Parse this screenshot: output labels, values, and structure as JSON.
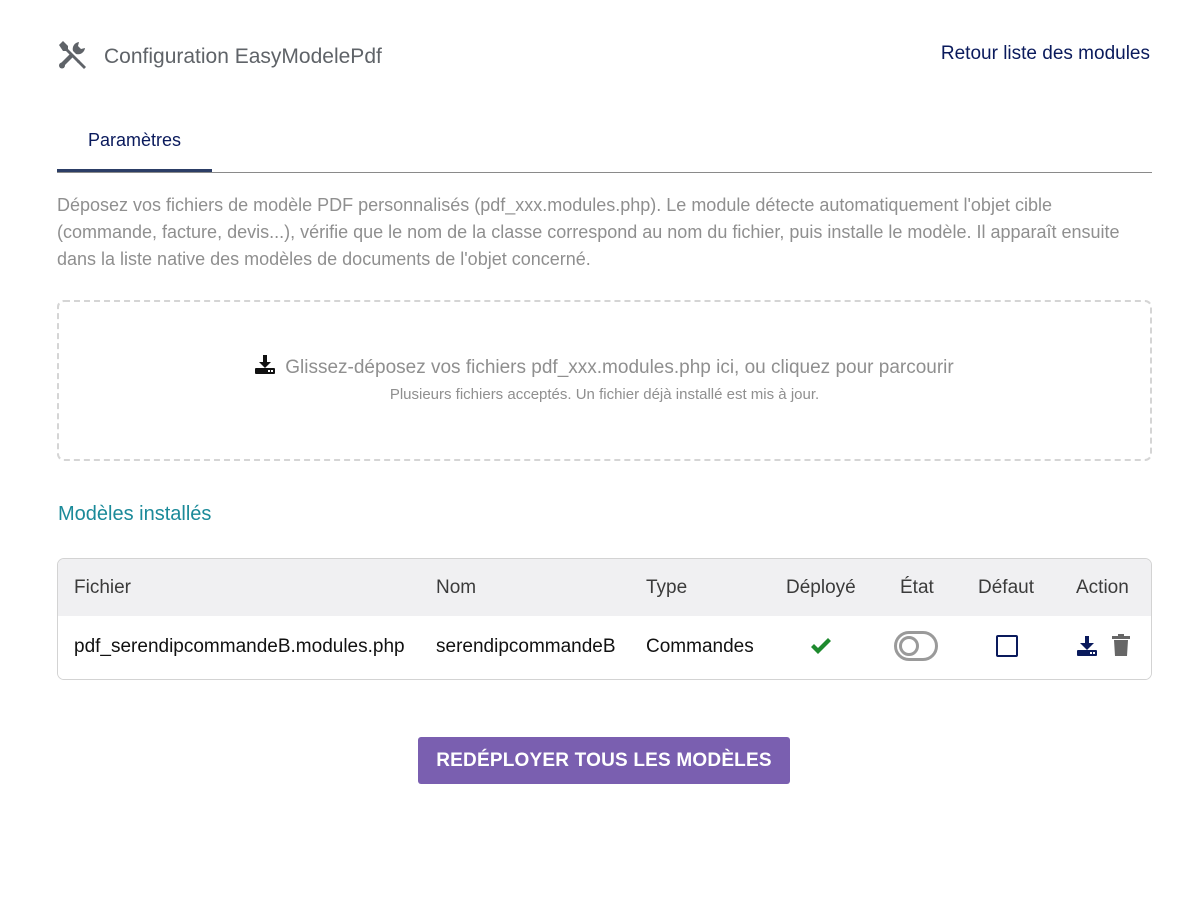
{
  "header": {
    "title": "Configuration EasyModelePdf",
    "back_link": "Retour liste des modules",
    "icon": "tools-icon"
  },
  "tabs": [
    {
      "label": "Paramètres",
      "active": true
    }
  ],
  "description": "Déposez vos fichiers de modèle PDF personnalisés (pdf_xxx.modules.php). Le module détecte automatiquement l'objet cible (commande, facture, devis...), vérifie que le nom de la classe correspond au nom du fichier, puis installe le modèle. Il apparaît ensuite dans la liste native des modèles de documents de l'objet concerné.",
  "dropzone": {
    "main_text": "Glissez-déposez vos fichiers pdf_xxx.modules.php ici, ou cliquez pour parcourir",
    "sub_text": "Plusieurs fichiers acceptés. Un fichier déjà installé est mis à jour.",
    "icon": "download-icon"
  },
  "installed": {
    "title": "Modèles installés",
    "columns": [
      "Fichier",
      "Nom",
      "Type",
      "Déployé",
      "État",
      "Défaut",
      "Action"
    ],
    "rows": [
      {
        "file": "pdf_serendipcommandeB.modules.php",
        "name": "serendipcommandeB",
        "type": "Commandes",
        "deployed": true,
        "state_enabled": false,
        "default": false
      }
    ]
  },
  "redeploy_button": "REDÉPLOYER TOUS LES MODÈLES",
  "colors": {
    "accent": "#7a5fb0",
    "link": "#0a1a5c",
    "section_title": "#1b8a99",
    "success": "#1e8a2e",
    "muted": "#8f8f8f"
  }
}
